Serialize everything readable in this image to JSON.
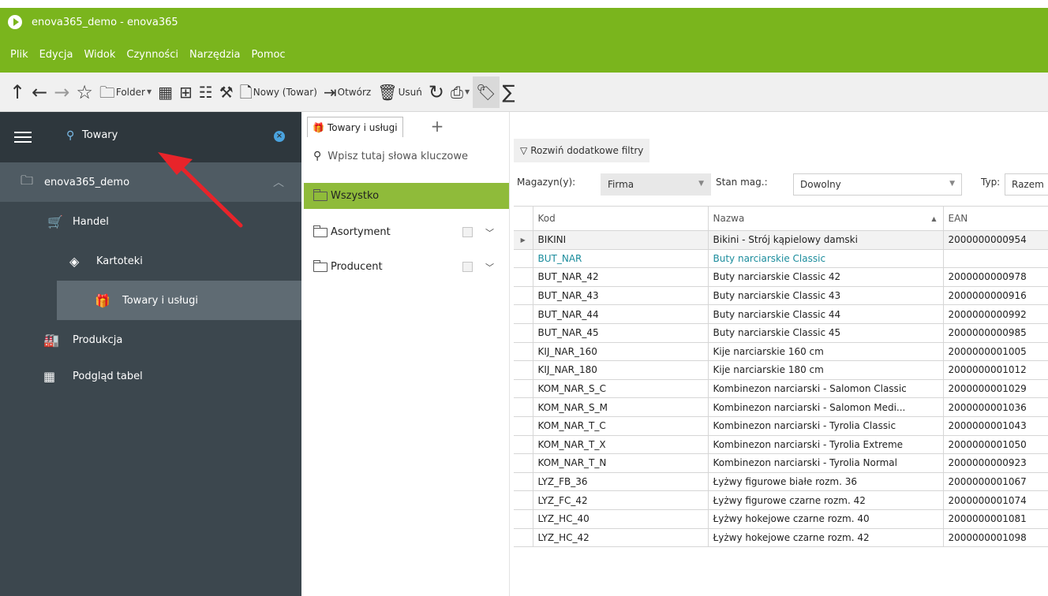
{
  "window": {
    "title": "enova365_demo - enova365"
  },
  "menu": [
    "Plik",
    "Edycja",
    "Widok",
    "Czynności",
    "Narzędzia",
    "Pomoc"
  ],
  "toolbar": {
    "folder_label": "Folder",
    "new_label": "Nowy (Towar)",
    "open_label": "Otwórz",
    "delete_label": "Usuń"
  },
  "sidebar": {
    "search_text": "Towary",
    "items": [
      {
        "label": "enova365_demo",
        "icon": "folder-icon"
      },
      {
        "label": "Handel",
        "icon": "cart-icon"
      },
      {
        "label": "Kartoteki",
        "icon": "layers-icon"
      },
      {
        "label": "Towary i usługi",
        "icon": "gift-icon"
      },
      {
        "label": "Produkcja",
        "icon": "factory-icon"
      },
      {
        "label": "Podgląd tabel",
        "icon": "table-icon"
      }
    ]
  },
  "panel": {
    "tab_label": "Towary i usługi",
    "search_placeholder": "Wpisz tutaj słowa kluczowe",
    "filters": [
      {
        "label": "Wszystko"
      },
      {
        "label": "Asortyment"
      },
      {
        "label": "Producent"
      }
    ]
  },
  "filters": {
    "more_filters_label": "Rozwiń dodatkowe filtry",
    "warehouse_label": "Magazyn(y):",
    "warehouse_value": "Firma",
    "stock_label": "Stan mag.:",
    "stock_value": "Dowolny",
    "type_label": "Typ:",
    "type_value": "Razem"
  },
  "grid": {
    "columns": [
      "Kod",
      "Nazwa",
      "EAN"
    ],
    "rows": [
      [
        "BIKINI",
        "Bikini - Strój kąpielowy damski",
        "2000000000954"
      ],
      [
        "BUT_NAR",
        "Buty narciarskie Classic",
        ""
      ],
      [
        "BUT_NAR_42",
        "Buty narciarskie Classic 42",
        "2000000000978"
      ],
      [
        "BUT_NAR_43",
        "Buty narciarskie Classic 43",
        "2000000000916"
      ],
      [
        "BUT_NAR_44",
        "Buty narciarskie Classic 44",
        "2000000000992"
      ],
      [
        "BUT_NAR_45",
        "Buty narciarskie Classic 45",
        "2000000000985"
      ],
      [
        "KIJ_NAR_160",
        "Kije narciarskie 160 cm",
        "2000000001005"
      ],
      [
        "KIJ_NAR_180",
        "Kije narciarskie 180 cm",
        "2000000001012"
      ],
      [
        "KOM_NAR_S_C",
        "Kombinezon narciarski - Salomon Classic",
        "2000000001029"
      ],
      [
        "KOM_NAR_S_M",
        "Kombinezon narciarski - Salomon Medi...",
        "2000000001036"
      ],
      [
        "KOM_NAR_T_C",
        "Kombinezon narciarski - Tyrolia Classic",
        "2000000001043"
      ],
      [
        "KOM_NAR_T_X",
        "Kombinezon narciarski - Tyrolia Extreme",
        "2000000001050"
      ],
      [
        "KOM_NAR_T_N",
        "Kombinezon narciarski - Tyrolia Normal",
        "2000000000923"
      ],
      [
        "LYZ_FB_36",
        "Łyżwy figurowe białe rozm. 36",
        "2000000001067"
      ],
      [
        "LYZ_FC_42",
        "Łyżwy figurowe czarne rozm. 42",
        "2000000001074"
      ],
      [
        "LYZ_HC_40",
        "Łyżwy hokejowe czarne rozm. 40",
        "2000000001081"
      ],
      [
        "LYZ_HC_42",
        "Łyżwy hokejowe czarne rozm. 42",
        "2000000001098"
      ]
    ]
  },
  "colors": {
    "brand_green": "#7ab51d",
    "sidebar_bg": "#3c474e",
    "active_filter": "#8fbb3a",
    "link_text": "#1a8c9c",
    "annotation_arrow": "#e8242a"
  }
}
